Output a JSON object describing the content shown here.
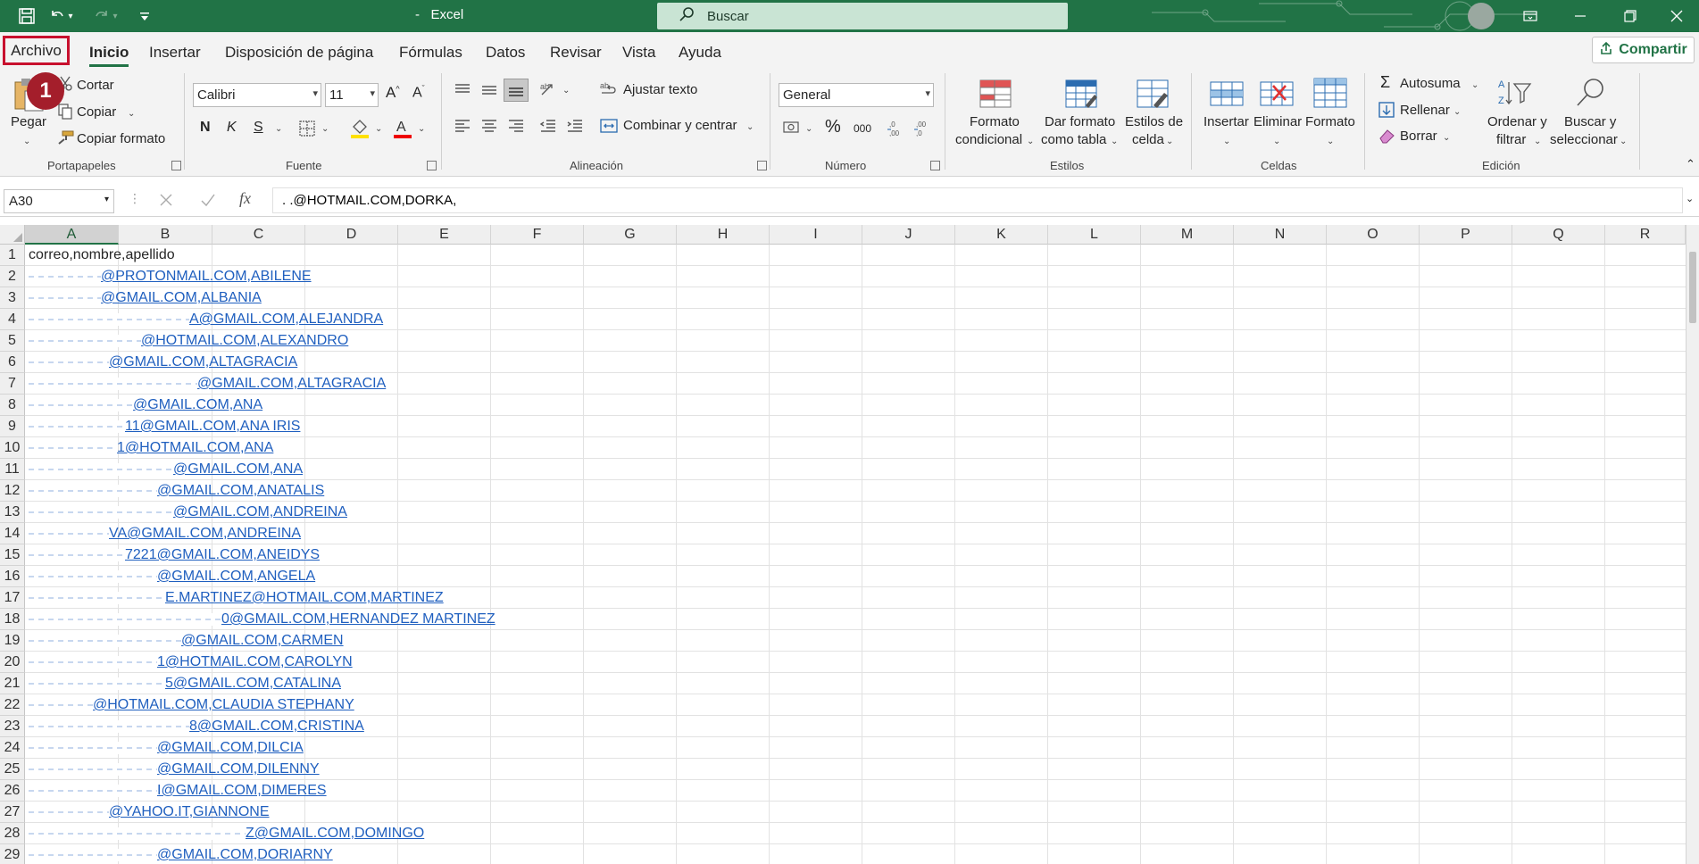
{
  "app": {
    "title": "Excel",
    "title_prefix": "-",
    "search_placeholder": "Buscar"
  },
  "menu": {
    "tabs": [
      "Archivo",
      "Inicio",
      "Insertar",
      "Disposición de página",
      "Fórmulas",
      "Datos",
      "Revisar",
      "Vista",
      "Ayuda"
    ],
    "share_label": "Compartir",
    "step_badge": "1"
  },
  "ribbon": {
    "clipboard": {
      "group": "Portapapeles",
      "paste": "Pegar",
      "cut": "Cortar",
      "copy": "Copiar",
      "format_painter": "Copiar formato"
    },
    "font": {
      "group": "Fuente",
      "name": "Calibri",
      "size": "11",
      "bold": "N",
      "italic": "K",
      "underline": "S"
    },
    "alignment": {
      "group": "Alineación",
      "wrap": "Ajustar texto",
      "merge": "Combinar y centrar"
    },
    "number": {
      "group": "Número",
      "format": "General",
      "percent": "%",
      "thousands": "000"
    },
    "styles": {
      "group": "Estilos",
      "conditional_1": "Formato",
      "conditional_2": "condicional",
      "table_1": "Dar formato",
      "table_2": "como tabla",
      "cell_1": "Estilos de",
      "cell_2": "celda"
    },
    "cells": {
      "group": "Celdas",
      "insert": "Insertar",
      "delete": "Eliminar",
      "format": "Formato"
    },
    "editing": {
      "group": "Edición",
      "autosum": "Autosuma",
      "fill": "Rellenar",
      "clear": "Borrar",
      "sort_1": "Ordenar y",
      "sort_2": "filtrar",
      "find_1": "Buscar y",
      "find_2": "seleccionar"
    }
  },
  "formula_bar": {
    "name_box": "A30",
    "fx": "fx",
    "formula": ".                              .@HOTMAIL.COM,DORKA,"
  },
  "sheet": {
    "columns": [
      "A",
      "B",
      "C",
      "D",
      "E",
      "F",
      "G",
      "H",
      "I",
      "J",
      "K",
      "L",
      "M",
      "N",
      "O",
      "P",
      "Q",
      "R"
    ],
    "selected_column": "A",
    "rows": [
      {
        "n": "1",
        "visible_text": "correo,nombre,apellido",
        "hidden_chars": 0,
        "link": false
      },
      {
        "n": "2",
        "visible_text": "@PROTONMAIL.COM,ABILENE",
        "hidden_chars": 9,
        "link": true
      },
      {
        "n": "3",
        "visible_text": "@GMAIL.COM,ALBANIA",
        "hidden_chars": 9,
        "link": true
      },
      {
        "n": "4",
        "visible_text": "A@GMAIL.COM,ALEJANDRA",
        "hidden_chars": 20,
        "link": true
      },
      {
        "n": "5",
        "visible_text": "@HOTMAIL.COM,ALEXANDRO",
        "hidden_chars": 14,
        "link": true
      },
      {
        "n": "6",
        "visible_text": "@GMAIL.COM,ALTAGRACIA",
        "hidden_chars": 10,
        "link": true
      },
      {
        "n": "7",
        "visible_text": "@GMAIL.COM,ALTAGRACIA",
        "hidden_chars": 21,
        "link": true
      },
      {
        "n": "8",
        "visible_text": "@GMAIL.COM,ANA",
        "hidden_chars": 13,
        "link": true
      },
      {
        "n": "9",
        "visible_text": "11@GMAIL.COM,ANA IRIS",
        "hidden_chars": 12,
        "link": true
      },
      {
        "n": "10",
        "visible_text": "1@HOTMAIL.COM,ANA",
        "hidden_chars": 11,
        "link": true
      },
      {
        "n": "11",
        "visible_text": "@GMAIL.COM,ANA",
        "hidden_chars": 18,
        "link": true
      },
      {
        "n": "12",
        "visible_text": "@GMAIL.COM,ANATALIS",
        "hidden_chars": 16,
        "link": true
      },
      {
        "n": "13",
        "visible_text": "@GMAIL.COM,ANDREINA",
        "hidden_chars": 18,
        "link": true
      },
      {
        "n": "14",
        "visible_text": "VA@GMAIL.COM,ANDREINA",
        "hidden_chars": 10,
        "link": true
      },
      {
        "n": "15",
        "visible_text": "7221@GMAIL.COM,ANEIDYS",
        "hidden_chars": 12,
        "link": true
      },
      {
        "n": "16",
        "visible_text": "@GMAIL.COM,ANGELA",
        "hidden_chars": 16,
        "link": true
      },
      {
        "n": "17",
        "visible_text": "E.MARTINEZ@HOTMAIL.COM,MARTINEZ",
        "hidden_chars": 17,
        "link": true
      },
      {
        "n": "18",
        "visible_text": "0@GMAIL.COM,HERNANDEZ MARTINEZ",
        "hidden_chars": 24,
        "link": true
      },
      {
        "n": "19",
        "visible_text": "@GMAIL.COM,CARMEN",
        "hidden_chars": 19,
        "link": true
      },
      {
        "n": "20",
        "visible_text": "1@HOTMAIL.COM,CAROLYN",
        "hidden_chars": 16,
        "link": true
      },
      {
        "n": "21",
        "visible_text": "5@GMAIL.COM,CATALINA",
        "hidden_chars": 17,
        "link": true
      },
      {
        "n": "22",
        "visible_text": "@HOTMAIL.COM,CLAUDIA STEPHANY",
        "hidden_chars": 8,
        "link": true
      },
      {
        "n": "23",
        "visible_text": "8@GMAIL.COM,CRISTINA",
        "hidden_chars": 20,
        "link": true
      },
      {
        "n": "24",
        "visible_text": "@GMAIL.COM,DILCIA",
        "hidden_chars": 16,
        "link": true
      },
      {
        "n": "25",
        "visible_text": "@GMAIL.COM,DILENNY",
        "hidden_chars": 16,
        "link": true
      },
      {
        "n": "26",
        "visible_text": "I@GMAIL.COM,DIMERES",
        "hidden_chars": 16,
        "link": true
      },
      {
        "n": "27",
        "visible_text": "@YAHOO.IT,GIANNONE",
        "hidden_chars": 10,
        "link": true
      },
      {
        "n": "28",
        "visible_text": "Z@GMAIL.COM,DOMINGO",
        "hidden_chars": 27,
        "link": true
      },
      {
        "n": "29",
        "visible_text": "@GMAIL.COM,DORIARNY",
        "hidden_chars": 16,
        "link": true
      }
    ]
  },
  "colors": {
    "excel_green": "#217346",
    "highlight_red": "#c8102e",
    "badge_red": "#a41e2b",
    "link_blue": "#1f5fbf"
  }
}
